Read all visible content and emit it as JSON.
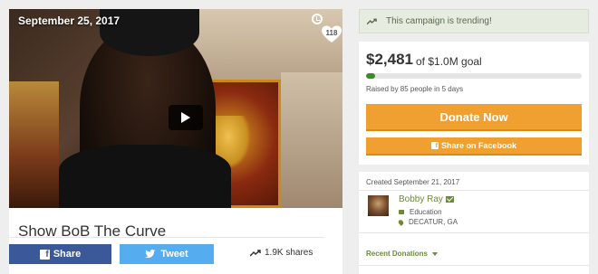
{
  "video": {
    "date": "September 25, 2017",
    "hearts": "118"
  },
  "campaign": {
    "title": "Show BoB The Curve",
    "share_fb_label": "Share",
    "share_tw_label": "Tweet",
    "shares_count": "1.9K shares"
  },
  "trending": {
    "text": "This campaign is trending!"
  },
  "funding": {
    "amount": "$2,481",
    "goal": "of $1.0M goal",
    "progress_fraction": 0.04,
    "raised_text": "Raised by 85 people in 5 days",
    "donate_label": "Donate Now",
    "fb_share_label": "Share on Facebook"
  },
  "organizer": {
    "created": "Created September 21, 2017",
    "name": "Bobby Ray",
    "category": "Education",
    "location": "DECATUR, GA",
    "recent_label": "Recent Donations"
  },
  "colors": {
    "facebook": "#3b5998",
    "twitter": "#55acee",
    "donate": "#f0a030",
    "accent": "#6b8a3a"
  },
  "icons": [
    "play-icon",
    "clock-icon",
    "heart-icon",
    "facebook-icon",
    "twitter-icon",
    "trending-icon",
    "mail-icon",
    "tag-icon",
    "map-pin-icon",
    "caret-down-icon"
  ]
}
